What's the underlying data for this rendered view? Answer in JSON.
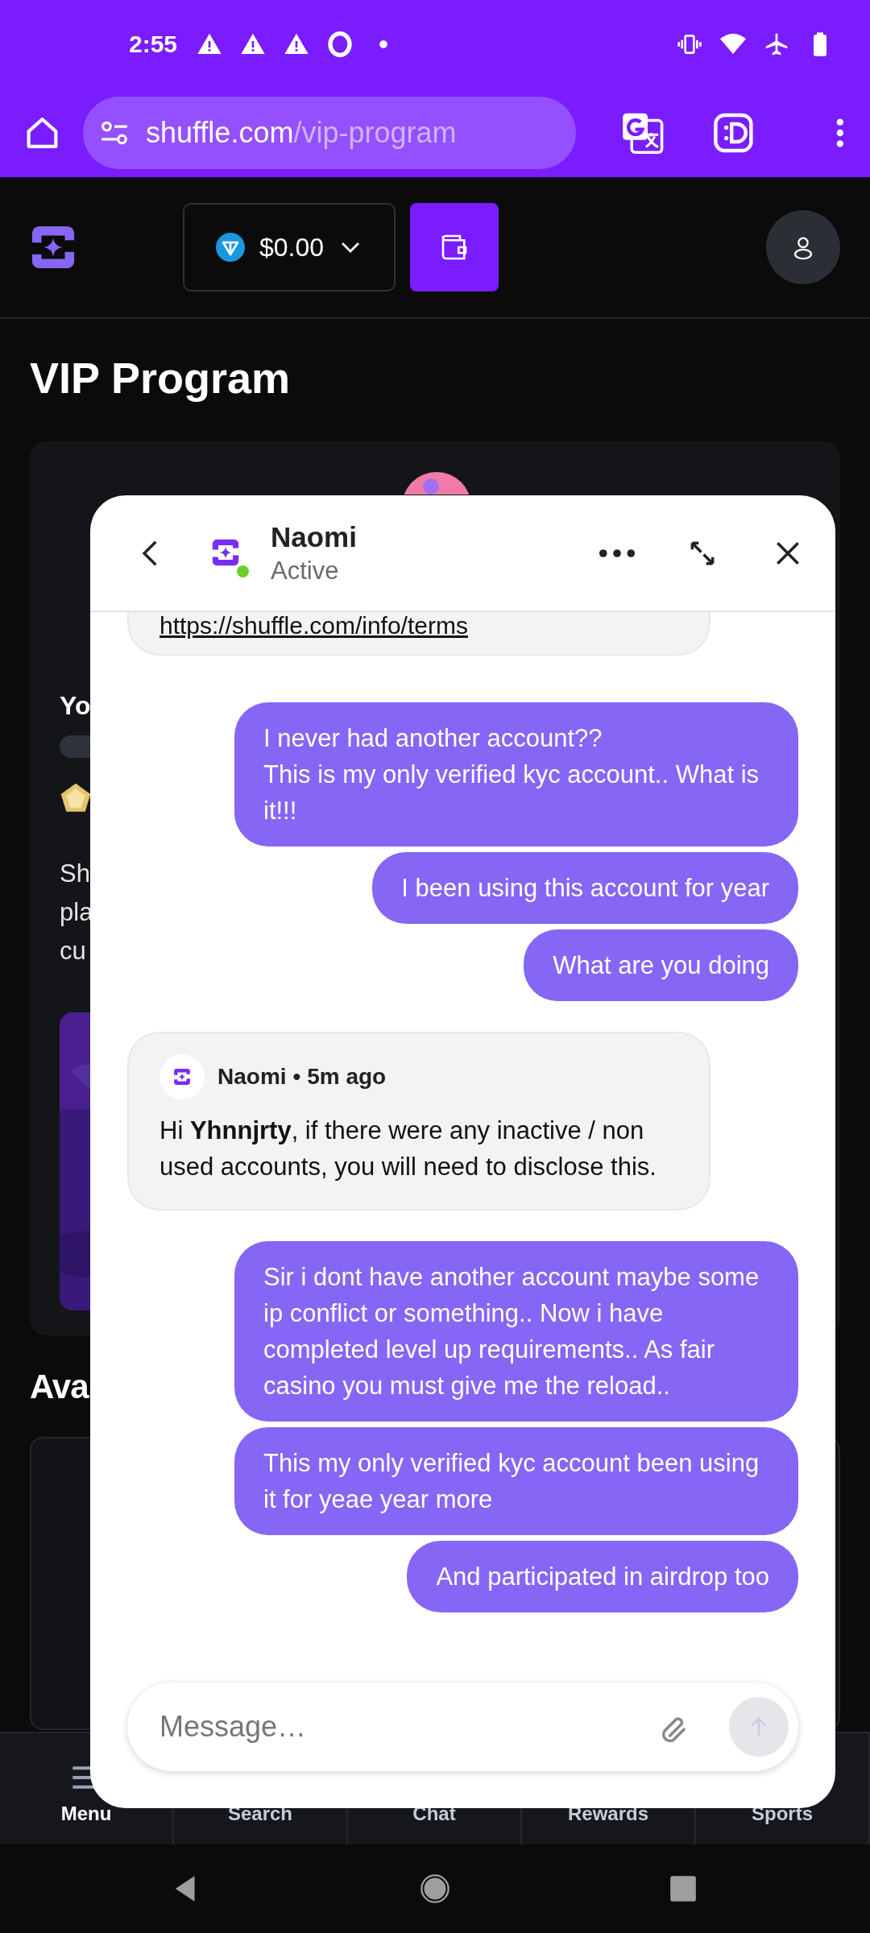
{
  "status_bar": {
    "time": "2:55"
  },
  "browser": {
    "url_host": "shuffle.com",
    "url_path": "/vip-program"
  },
  "site_header": {
    "balance": "$0.00"
  },
  "page": {
    "title": "VIP Program",
    "card_heading": "Yo",
    "card_lines": [
      "Sh",
      "pla",
      "cu"
    ],
    "section_title": "Ava"
  },
  "chat": {
    "agent_name": "Naomi",
    "status": "Active",
    "online": true,
    "messages": [
      {
        "kind": "link",
        "text": "https://shuffle.com/info/terms"
      },
      {
        "kind": "user",
        "text": "I never had another account??\nThis is my only verified kyc account.. What is it!!!"
      },
      {
        "kind": "user",
        "text": "I been using this account for year"
      },
      {
        "kind": "user",
        "text": "What are you doing"
      },
      {
        "kind": "agent",
        "author": "Naomi",
        "time": "• 5m ago",
        "text": "Hi **Yhnnjrty**, if there were any inactive / non used accounts, you will need to disclose this."
      },
      {
        "kind": "user",
        "text": "Sir i dont have another account maybe some ip conflict or something.. Now i have completed level up requirements.. As fair casino you must give me the reload.."
      },
      {
        "kind": "user",
        "text": "This my only verified kyc account been using it for yeae year more"
      },
      {
        "kind": "user",
        "text": "And participated in airdrop too"
      }
    ],
    "input": {
      "placeholder": "Message…"
    }
  },
  "bottom_nav": [
    {
      "label": "Menu",
      "selected": true
    },
    {
      "label": "Search",
      "selected": false
    },
    {
      "label": "Chat",
      "selected": false
    },
    {
      "label": "Rewards",
      "selected": false
    },
    {
      "label": "Sports",
      "selected": false
    }
  ]
}
